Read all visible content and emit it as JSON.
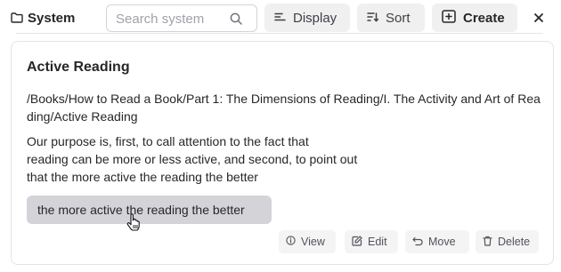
{
  "toolbar": {
    "breadcrumb": {
      "icon": "folder-icon",
      "label": "System"
    },
    "search": {
      "placeholder": "Search system",
      "value": "",
      "icon": "search-icon"
    },
    "buttons": {
      "display": {
        "label": "Display",
        "icon": "display-options-icon"
      },
      "sort": {
        "label": "Sort",
        "icon": "sort-icon"
      },
      "create": {
        "label": "Create",
        "icon": "file-plus-icon"
      }
    },
    "close_icon": "close-icon"
  },
  "card": {
    "title": "Active Reading",
    "path": "/Books/How to Read a Book/Part 1: The Dimensions of Reading/I. The Activity and Art of Reading/Active Reading",
    "body_lines": [
      "Our purpose is, first, to call attention to the fact that",
      "reading can be more or less active, and second, to point out",
      "that the more active the reading the better"
    ],
    "highlight": "the more active the reading the better",
    "actions": {
      "view": {
        "label": "View",
        "icon": "info-icon"
      },
      "edit": {
        "label": "Edit",
        "icon": "edit-icon"
      },
      "move": {
        "label": "Move",
        "icon": "move-icon"
      },
      "delete": {
        "label": "Delete",
        "icon": "trash-icon"
      }
    }
  },
  "colors": {
    "text": "#27272a",
    "muted": "#52525b",
    "button_bg": "#f0f0f1",
    "highlight_bg": "#d4d4d8",
    "border": "#e4e4e7"
  }
}
